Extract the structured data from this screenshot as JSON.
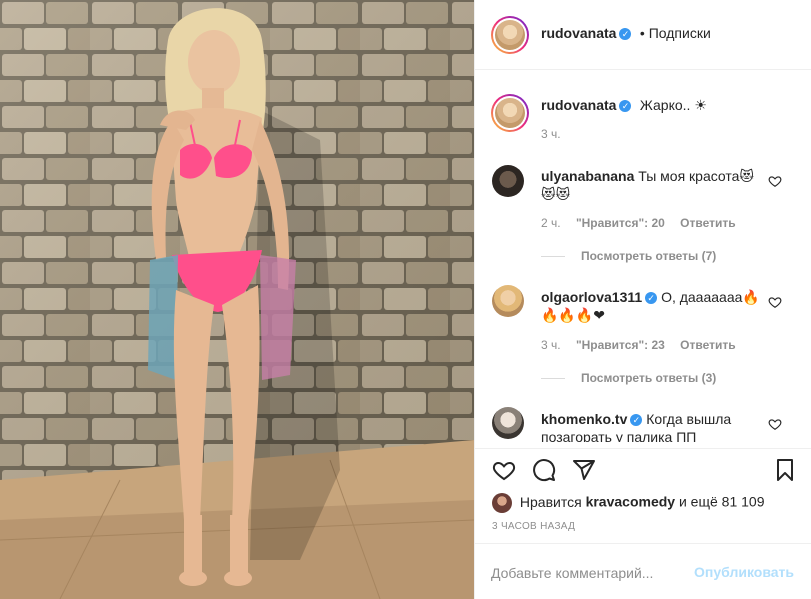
{
  "post": {
    "author": "rudovanata",
    "follow_label": "• Подписки",
    "caption_author": "rudovanata",
    "caption_text": "Жарко.. ☀",
    "caption_time": "3 ч."
  },
  "comments": [
    {
      "author": "ulyanabanana",
      "text_line1": "Ты моя красота😻",
      "text_line2": "😻😻",
      "time": "2 ч.",
      "likes": "\"Нравится\": 20",
      "reply": "Ответить",
      "view_replies": "Посмотреть ответы (7)",
      "verified": false
    },
    {
      "author": "olgaorlova1311",
      "text_line1": "О, дааааааа🔥",
      "text_line2": "🔥🔥🔥❤",
      "time": "3 ч.",
      "likes": "\"Нравится\": 23",
      "reply": "Ответить",
      "view_replies": "Посмотреть ответы (3)",
      "verified": true
    },
    {
      "author": "khomenko.tv",
      "text_line1": "Когда вышла",
      "text_line2": "позагорать у палика ПП",
      "verified": true
    }
  ],
  "likes_prefix": "Нравится",
  "likes_user": "kravacomedy",
  "likes_suffix": "и ещё 81 109",
  "time_ago": "3 ЧАСОВ НАЗАД",
  "comment_placeholder": "Добавьте комментарий...",
  "publish_label": "Опубликовать",
  "icons": {
    "like": "heart-icon",
    "comment": "comment-icon",
    "share": "share-icon",
    "save": "bookmark-icon"
  },
  "colors": {
    "verified": "#3897f0",
    "publish_disabled": "#b2dffc",
    "muted": "#8e8e8e"
  }
}
